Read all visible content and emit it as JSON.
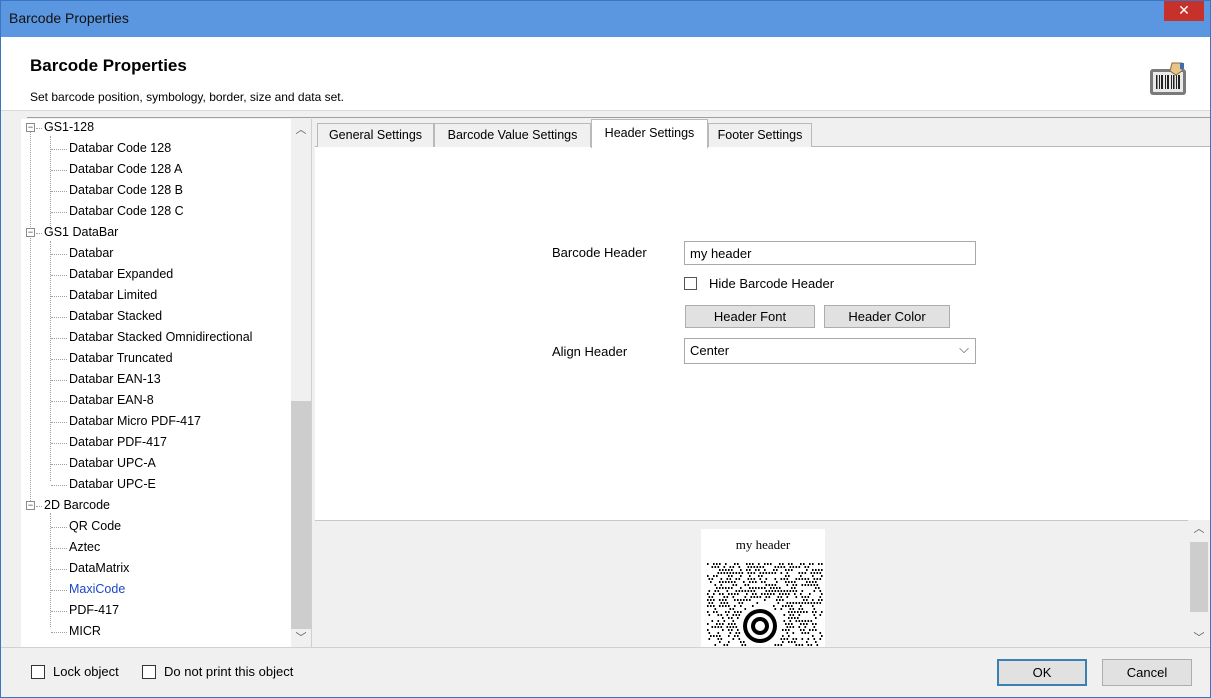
{
  "window": {
    "title": "Barcode Properties",
    "close_glyph": "✕"
  },
  "header": {
    "title": "Barcode Properties",
    "subtitle": "Set barcode position, symbology, border, size and data set.",
    "icon": "barcode-printer-icon"
  },
  "tree": {
    "groups": [
      {
        "label": "GS1-128",
        "expanded": true,
        "items": [
          "Databar Code 128",
          "Databar Code 128 A",
          "Databar Code 128 B",
          "Databar Code 128 C"
        ]
      },
      {
        "label": "GS1 DataBar",
        "expanded": true,
        "items": [
          "Databar",
          "Databar Expanded",
          "Databar Limited",
          "Databar Stacked",
          "Databar Stacked Omnidirectional",
          "Databar Truncated",
          "Databar EAN-13",
          "Databar EAN-8",
          "Databar Micro PDF-417",
          "Databar PDF-417",
          "Databar UPC-A",
          "Databar UPC-E"
        ]
      },
      {
        "label": "2D Barcode",
        "expanded": true,
        "items": [
          "QR Code",
          "Aztec",
          "DataMatrix",
          "MaxiCode",
          "PDF-417",
          "MICR"
        ]
      }
    ],
    "selected": "MaxiCode",
    "collapse_glyph": "−"
  },
  "tabs": [
    {
      "label": "General Settings",
      "active": false
    },
    {
      "label": "Barcode Value Settings",
      "active": false
    },
    {
      "label": "Header Settings",
      "active": true
    },
    {
      "label": "Footer Settings",
      "active": false
    }
  ],
  "header_settings": {
    "barcode_header_label": "Barcode Header",
    "barcode_header_value": "my header",
    "hide_header_label": "Hide Barcode Header",
    "hide_header_checked": false,
    "header_font_button": "Header Font",
    "header_color_button": "Header Color",
    "align_header_label": "Align Header",
    "align_header_value": "Center"
  },
  "preview": {
    "header_text": "my header",
    "symbology": "MaxiCode"
  },
  "footer": {
    "lock_object_label": "Lock object",
    "lock_object_checked": false,
    "do_not_print_label": "Do not print this object",
    "do_not_print_checked": false,
    "ok_button": "OK",
    "cancel_button": "Cancel"
  },
  "glyphs": {
    "scroll_up": "︿",
    "scroll_down": "﹀",
    "combo_arrow": "⌵"
  }
}
